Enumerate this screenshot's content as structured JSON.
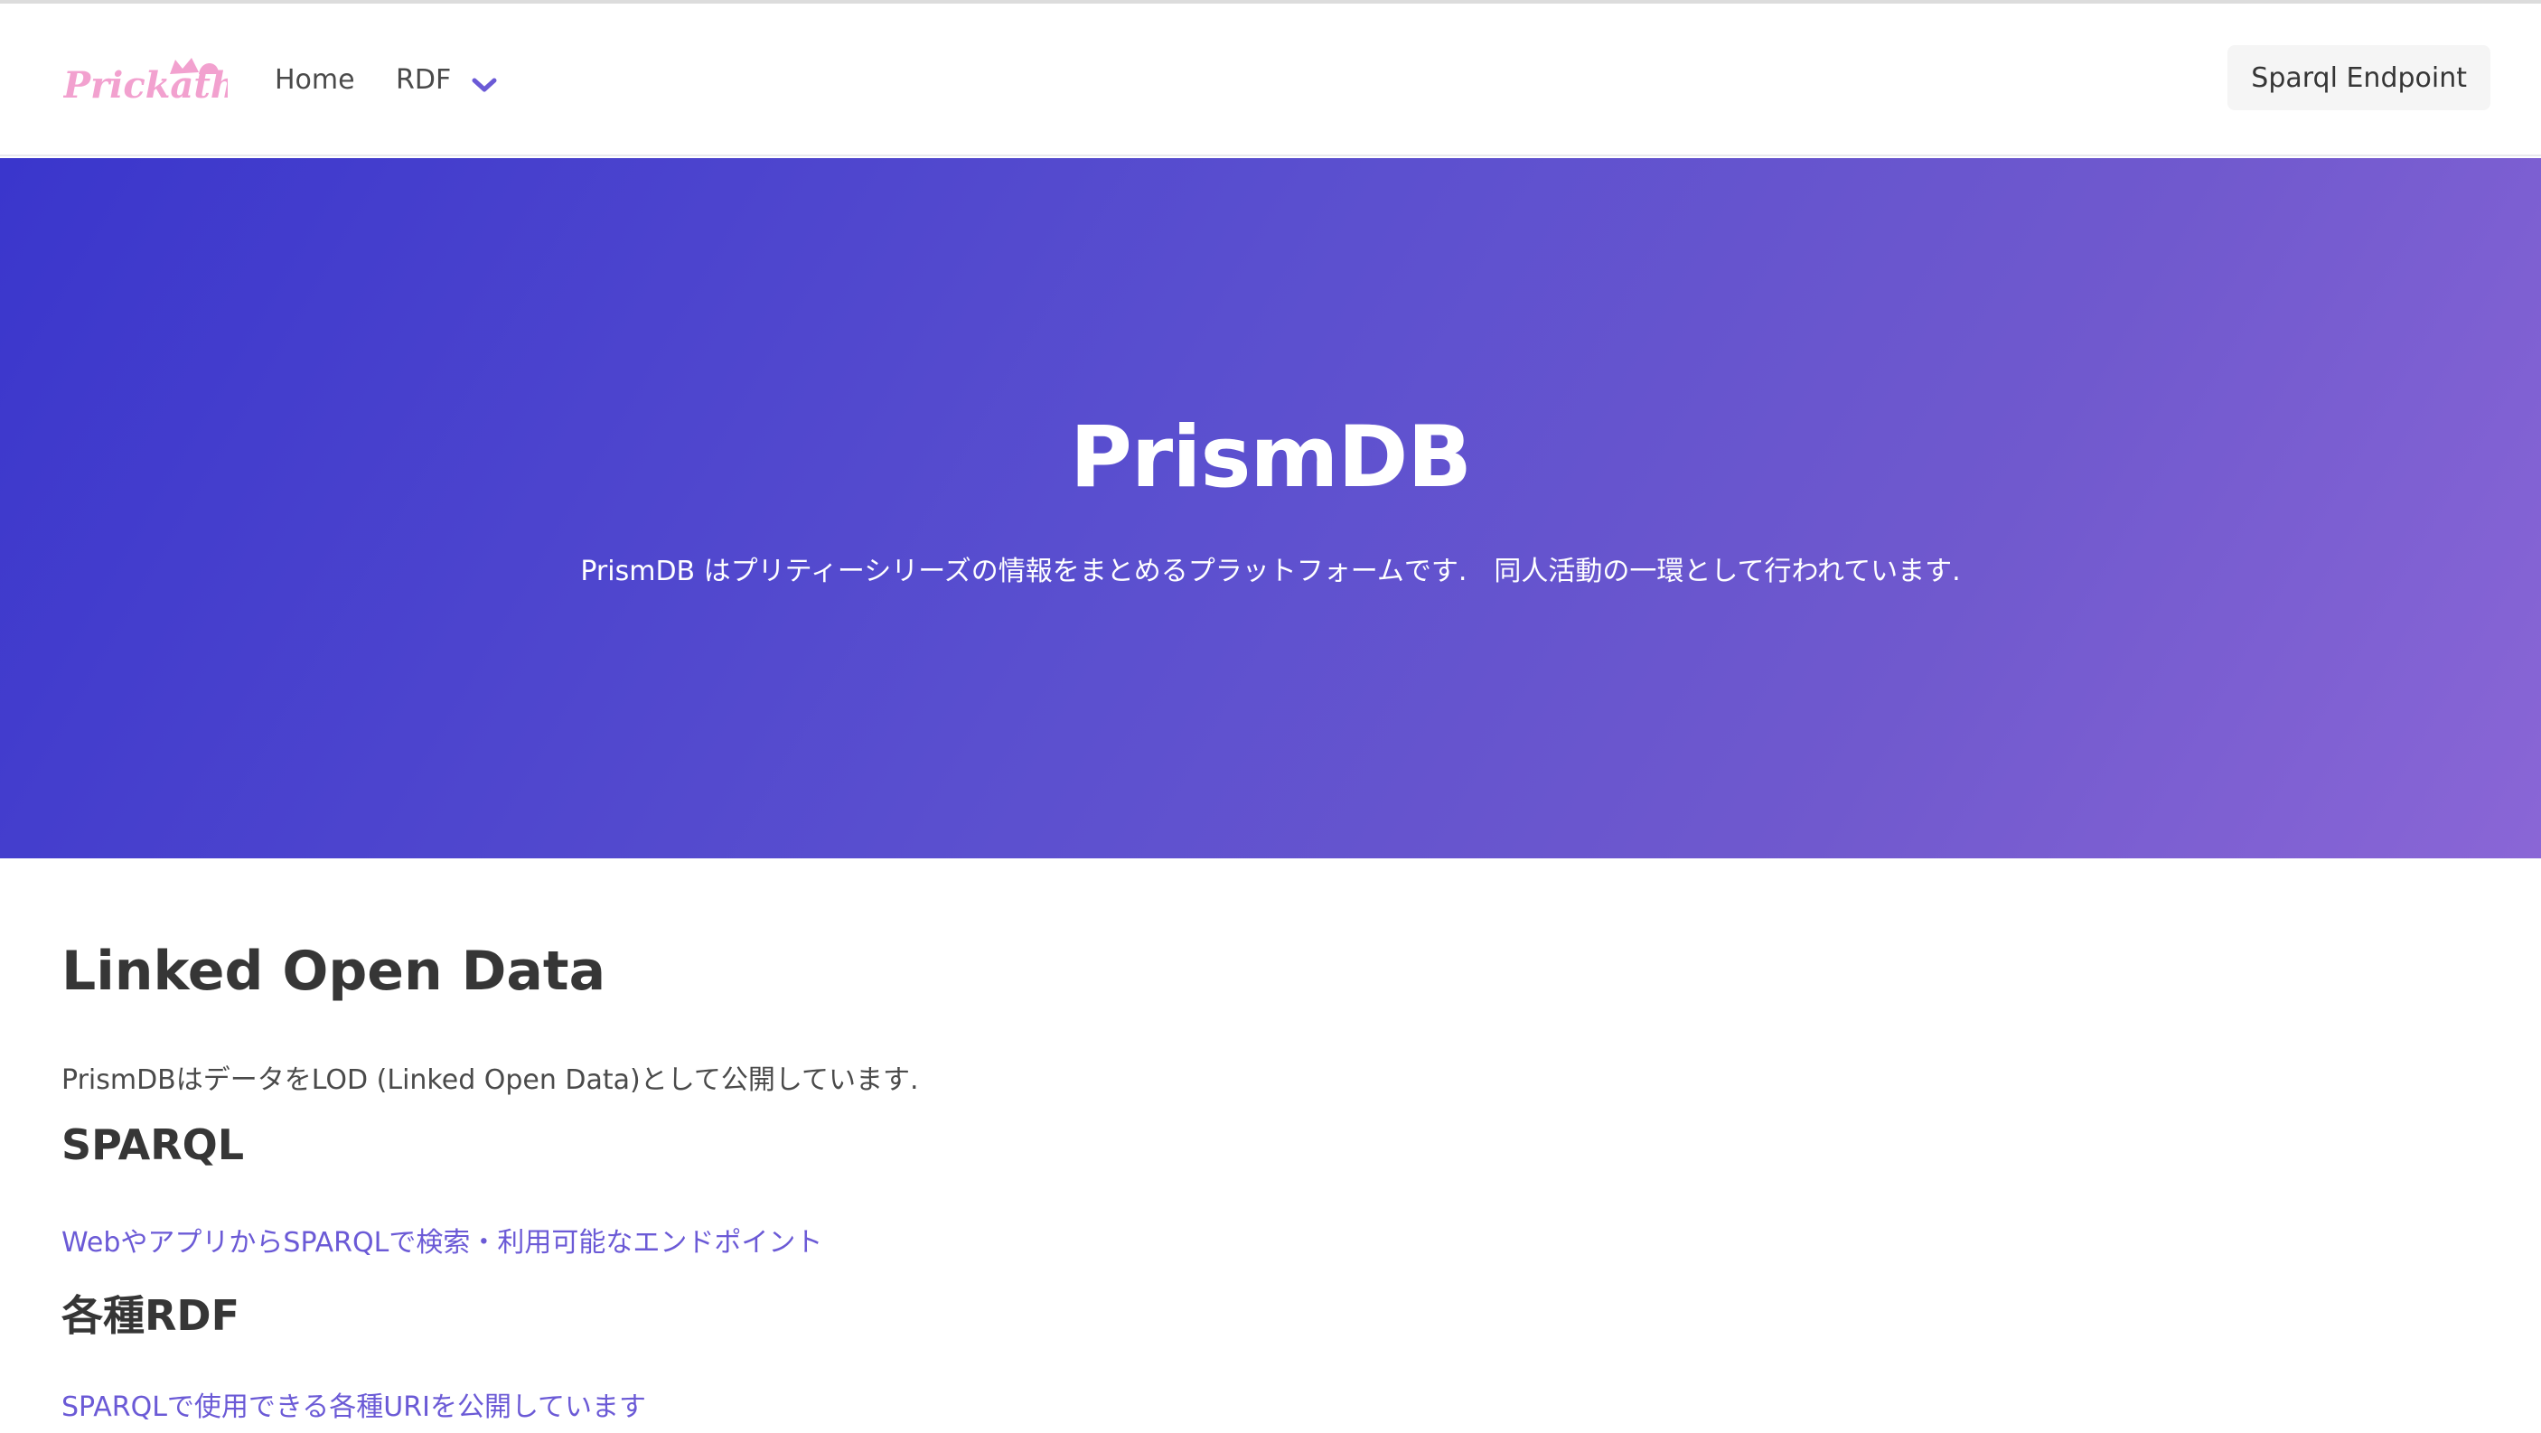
{
  "navbar": {
    "logo_text": "Prickathon",
    "items": [
      {
        "label": "Home"
      },
      {
        "label": "RDF"
      }
    ],
    "endpoint_button": "Sparql Endpoint"
  },
  "hero": {
    "title": "PrismDB",
    "subtitle": "PrismDB はプリティーシリーズの情報をまとめるプラットフォームです.　同人活動の一環として行われています."
  },
  "main": {
    "section_title": "Linked Open Data",
    "intro": "PrismDBはデータをLOD (Linked Open Data)として公開しています.",
    "sparql": {
      "heading": "SPARQL",
      "link": "WebやアプリからSPARQLで検索・利用可能なエンドポイント"
    },
    "rdf": {
      "heading": "各種RDF",
      "link": "SPARQLで使用できる各種URIを公開しています"
    }
  },
  "colors": {
    "logo": "#f2a1cf",
    "accent": "#6b5ad6",
    "hero_start": "#3a36cc",
    "hero_end": "#8a66d6"
  }
}
